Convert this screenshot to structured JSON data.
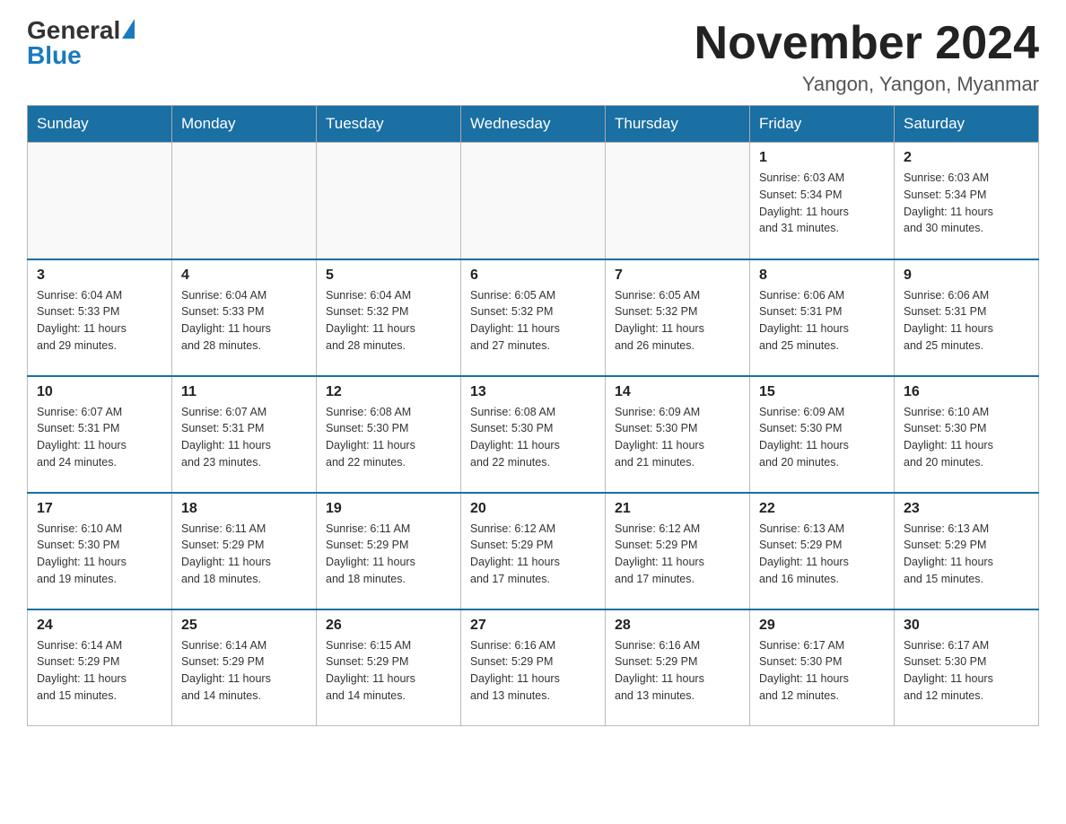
{
  "logo": {
    "general": "General",
    "blue": "Blue"
  },
  "title": "November 2024",
  "location": "Yangon, Yangon, Myanmar",
  "days_of_week": [
    "Sunday",
    "Monday",
    "Tuesday",
    "Wednesday",
    "Thursday",
    "Friday",
    "Saturday"
  ],
  "weeks": [
    [
      {
        "day": "",
        "info": ""
      },
      {
        "day": "",
        "info": ""
      },
      {
        "day": "",
        "info": ""
      },
      {
        "day": "",
        "info": ""
      },
      {
        "day": "",
        "info": ""
      },
      {
        "day": "1",
        "info": "Sunrise: 6:03 AM\nSunset: 5:34 PM\nDaylight: 11 hours\nand 31 minutes."
      },
      {
        "day": "2",
        "info": "Sunrise: 6:03 AM\nSunset: 5:34 PM\nDaylight: 11 hours\nand 30 minutes."
      }
    ],
    [
      {
        "day": "3",
        "info": "Sunrise: 6:04 AM\nSunset: 5:33 PM\nDaylight: 11 hours\nand 29 minutes."
      },
      {
        "day": "4",
        "info": "Sunrise: 6:04 AM\nSunset: 5:33 PM\nDaylight: 11 hours\nand 28 minutes."
      },
      {
        "day": "5",
        "info": "Sunrise: 6:04 AM\nSunset: 5:32 PM\nDaylight: 11 hours\nand 28 minutes."
      },
      {
        "day": "6",
        "info": "Sunrise: 6:05 AM\nSunset: 5:32 PM\nDaylight: 11 hours\nand 27 minutes."
      },
      {
        "day": "7",
        "info": "Sunrise: 6:05 AM\nSunset: 5:32 PM\nDaylight: 11 hours\nand 26 minutes."
      },
      {
        "day": "8",
        "info": "Sunrise: 6:06 AM\nSunset: 5:31 PM\nDaylight: 11 hours\nand 25 minutes."
      },
      {
        "day": "9",
        "info": "Sunrise: 6:06 AM\nSunset: 5:31 PM\nDaylight: 11 hours\nand 25 minutes."
      }
    ],
    [
      {
        "day": "10",
        "info": "Sunrise: 6:07 AM\nSunset: 5:31 PM\nDaylight: 11 hours\nand 24 minutes."
      },
      {
        "day": "11",
        "info": "Sunrise: 6:07 AM\nSunset: 5:31 PM\nDaylight: 11 hours\nand 23 minutes."
      },
      {
        "day": "12",
        "info": "Sunrise: 6:08 AM\nSunset: 5:30 PM\nDaylight: 11 hours\nand 22 minutes."
      },
      {
        "day": "13",
        "info": "Sunrise: 6:08 AM\nSunset: 5:30 PM\nDaylight: 11 hours\nand 22 minutes."
      },
      {
        "day": "14",
        "info": "Sunrise: 6:09 AM\nSunset: 5:30 PM\nDaylight: 11 hours\nand 21 minutes."
      },
      {
        "day": "15",
        "info": "Sunrise: 6:09 AM\nSunset: 5:30 PM\nDaylight: 11 hours\nand 20 minutes."
      },
      {
        "day": "16",
        "info": "Sunrise: 6:10 AM\nSunset: 5:30 PM\nDaylight: 11 hours\nand 20 minutes."
      }
    ],
    [
      {
        "day": "17",
        "info": "Sunrise: 6:10 AM\nSunset: 5:30 PM\nDaylight: 11 hours\nand 19 minutes."
      },
      {
        "day": "18",
        "info": "Sunrise: 6:11 AM\nSunset: 5:29 PM\nDaylight: 11 hours\nand 18 minutes."
      },
      {
        "day": "19",
        "info": "Sunrise: 6:11 AM\nSunset: 5:29 PM\nDaylight: 11 hours\nand 18 minutes."
      },
      {
        "day": "20",
        "info": "Sunrise: 6:12 AM\nSunset: 5:29 PM\nDaylight: 11 hours\nand 17 minutes."
      },
      {
        "day": "21",
        "info": "Sunrise: 6:12 AM\nSunset: 5:29 PM\nDaylight: 11 hours\nand 17 minutes."
      },
      {
        "day": "22",
        "info": "Sunrise: 6:13 AM\nSunset: 5:29 PM\nDaylight: 11 hours\nand 16 minutes."
      },
      {
        "day": "23",
        "info": "Sunrise: 6:13 AM\nSunset: 5:29 PM\nDaylight: 11 hours\nand 15 minutes."
      }
    ],
    [
      {
        "day": "24",
        "info": "Sunrise: 6:14 AM\nSunset: 5:29 PM\nDaylight: 11 hours\nand 15 minutes."
      },
      {
        "day": "25",
        "info": "Sunrise: 6:14 AM\nSunset: 5:29 PM\nDaylight: 11 hours\nand 14 minutes."
      },
      {
        "day": "26",
        "info": "Sunrise: 6:15 AM\nSunset: 5:29 PM\nDaylight: 11 hours\nand 14 minutes."
      },
      {
        "day": "27",
        "info": "Sunrise: 6:16 AM\nSunset: 5:29 PM\nDaylight: 11 hours\nand 13 minutes."
      },
      {
        "day": "28",
        "info": "Sunrise: 6:16 AM\nSunset: 5:29 PM\nDaylight: 11 hours\nand 13 minutes."
      },
      {
        "day": "29",
        "info": "Sunrise: 6:17 AM\nSunset: 5:30 PM\nDaylight: 11 hours\nand 12 minutes."
      },
      {
        "day": "30",
        "info": "Sunrise: 6:17 AM\nSunset: 5:30 PM\nDaylight: 11 hours\nand 12 minutes."
      }
    ]
  ]
}
